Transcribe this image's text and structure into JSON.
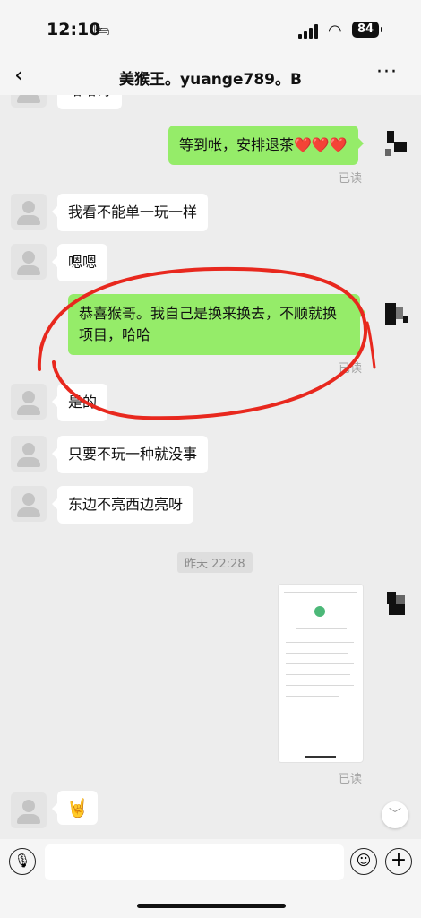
{
  "status_bar": {
    "time": "12:10",
    "battery": "84"
  },
  "header": {
    "back_icon": "‹",
    "title": "美猴王。yuange789。B",
    "more_icon": "···"
  },
  "messages": {
    "top_partial": "哈哈哥",
    "m1": "等到帐，安排退茶❤️❤️❤️",
    "m1_read": "已读",
    "m2": "我看不能单一玩一样",
    "m3": "嗯嗯",
    "m4_line1": "恭喜猴哥。我自己是换来换去，不顺就换",
    "m4_line2": "项目，哈哈",
    "m4_read": "已读",
    "m5": "是的",
    "m6": "只要不玩一种就没事",
    "m7": "东边不亮西边亮呀",
    "timestamp": "昨天 22:28",
    "image_read": "已读",
    "last": "🤘"
  },
  "input_bar": {
    "placeholder": ""
  },
  "colors": {
    "outgoing_bubble": "#95ec69",
    "incoming_bubble": "#ffffff",
    "annotation": "#e8281e"
  }
}
